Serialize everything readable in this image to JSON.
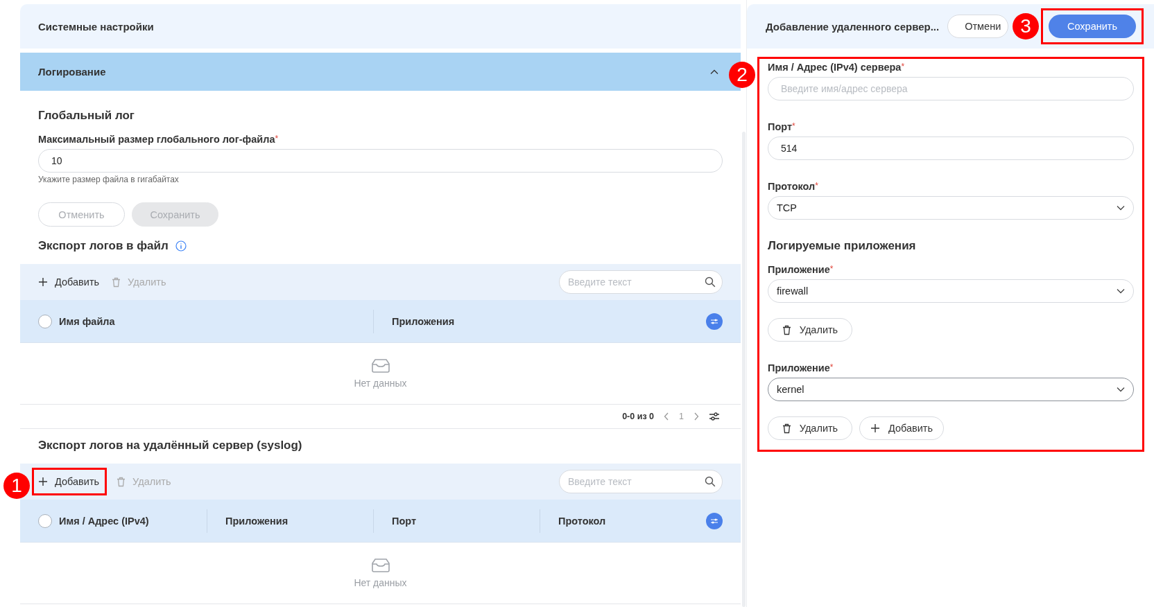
{
  "left_panel": {
    "title": "Системные настройки",
    "section": {
      "title": "Логирование",
      "expanded": true
    },
    "global_log": {
      "title": "Глобальный лог",
      "field": {
        "label": "Максимальный размер глобального лог-файла",
        "required_mark": "*",
        "value": "10",
        "hint": "Укажите размер файла в гигабайтах"
      },
      "buttons": [
        {
          "label": "Отменить",
          "kind": "outline",
          "disabled": true
        },
        {
          "label": "Сохранить",
          "kind": "filled",
          "disabled": true
        }
      ]
    },
    "tables": [
      {
        "title": "Экспорт логов в файл",
        "info": true,
        "select_all_checked": false,
        "toolbar": {
          "add": "Добавить",
          "delete": "Удалить",
          "delete_disabled": true,
          "search_placeholder": "Введите текст"
        },
        "columns": [
          "Имя файла",
          "Приложения"
        ],
        "empty_text": "Нет данных",
        "pagination": {
          "range": "0-0 из 0",
          "page": "1"
        }
      },
      {
        "title": "Экспорт логов на удалённый сервер (syslog)",
        "select_all_checked": false,
        "toolbar": {
          "add": "Добавить",
          "add_annotation": "1",
          "delete": "Удалить",
          "delete_disabled": true,
          "search_placeholder": "Введите текст"
        },
        "columns": [
          "Имя / Адрес (IPv4)",
          "Приложения",
          "Порт",
          "Протокол"
        ],
        "empty_text": "Нет данных"
      }
    ]
  },
  "drawer": {
    "title": "Добавление удаленного сервер...",
    "cancel": "Отмени",
    "save": "Сохранить",
    "save_annotation": "3",
    "form_annotation": "2",
    "fields": [
      {
        "kind": "input",
        "label": "Имя / Адрес (IPv4) сервера",
        "required_mark": "*",
        "placeholder": "Введите имя/адрес сервера"
      },
      {
        "kind": "input",
        "label": "Порт",
        "required_mark": "*",
        "value": "514"
      },
      {
        "kind": "select",
        "label": "Протокол",
        "required_mark": "*",
        "value": "TCP"
      }
    ],
    "apps_title": "Логируемые приложения",
    "apps": [
      {
        "label": "Приложение",
        "required_mark": "*",
        "value": "firewall",
        "focused": false,
        "delete": "Удалить"
      },
      {
        "label": "Приложение",
        "required_mark": "*",
        "value": "kernel",
        "focused": true,
        "delete": "Удалить"
      }
    ],
    "add": "Добавить"
  }
}
